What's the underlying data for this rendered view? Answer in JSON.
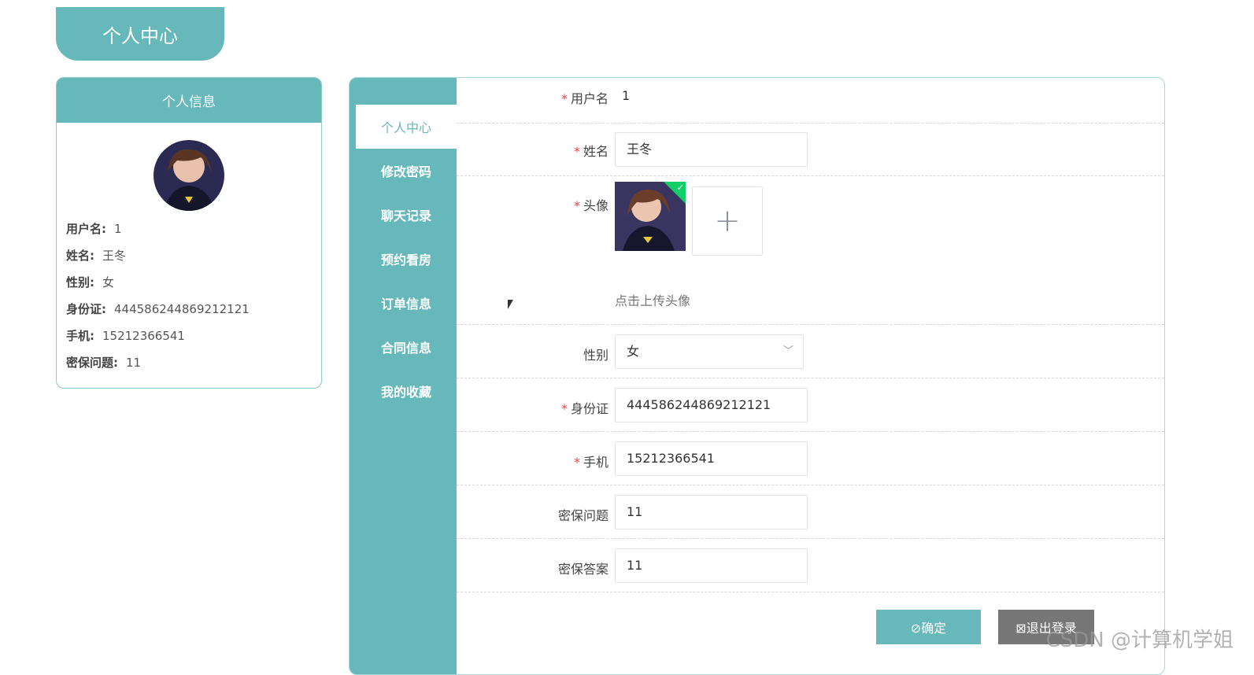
{
  "page_title": "个人中心",
  "profile_card": {
    "title": "个人信息",
    "rows": [
      {
        "label": "用户名:",
        "value": "1"
      },
      {
        "label": "姓名:",
        "value": "王冬"
      },
      {
        "label": "性别:",
        "value": "女"
      },
      {
        "label": "身份证:",
        "value": "444586244869212121"
      },
      {
        "label": "手机:",
        "value": "15212366541"
      },
      {
        "label": "密保问题:",
        "value": "11"
      }
    ]
  },
  "sidebar": {
    "items": [
      {
        "label": "个人中心",
        "active": true
      },
      {
        "label": "修改密码",
        "active": false
      },
      {
        "label": "聊天记录",
        "active": false
      },
      {
        "label": "预约看房",
        "active": false
      },
      {
        "label": "订单信息",
        "active": false
      },
      {
        "label": "合同信息",
        "active": false
      },
      {
        "label": "我的收藏",
        "active": false
      }
    ]
  },
  "form": {
    "required_mark": "*",
    "username": {
      "label": "用户名",
      "value": "1"
    },
    "name": {
      "label": "姓名",
      "value": "王冬"
    },
    "avatar": {
      "label": "头像",
      "upload_hint": "点击上传头像",
      "upload_glyph": "+"
    },
    "gender": {
      "label": "性别",
      "value": "女"
    },
    "idcard": {
      "label": "身份证",
      "value": "444586244869212121"
    },
    "phone": {
      "label": "手机",
      "value": "15212366541"
    },
    "question": {
      "label": "密保问题",
      "value": "11"
    },
    "answer": {
      "label": "密保答案",
      "value": "11"
    },
    "confirm_label": "⊘确定",
    "logout_label": "⊠退出登录"
  },
  "watermark": "CSDN @计算机学姐",
  "colors": {
    "accent": "#67b8bb",
    "required": "#e64242",
    "logout": "#777777"
  }
}
